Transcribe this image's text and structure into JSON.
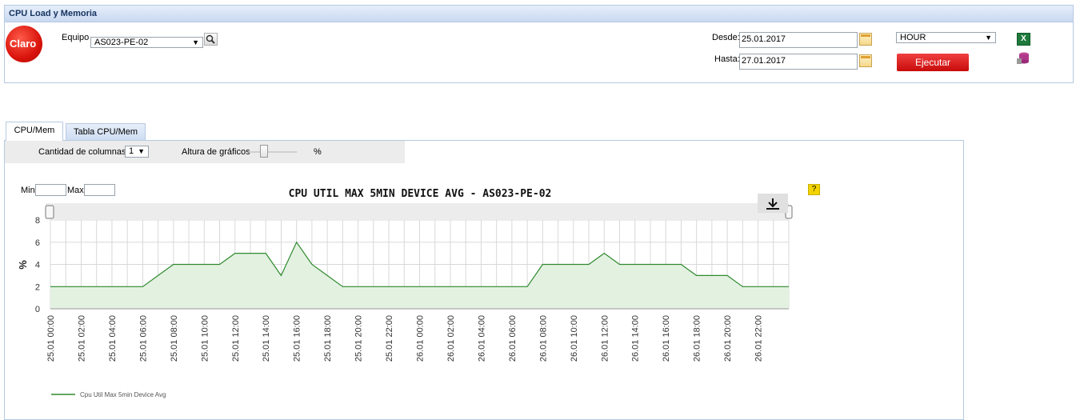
{
  "panel": {
    "title": "CPU Load y Memoria"
  },
  "logo": {
    "text": "Claro"
  },
  "equipo": {
    "label": "Equipo",
    "value": "AS023-PE-02"
  },
  "desde": {
    "label": "Desde:",
    "value": "25.01.2017"
  },
  "hasta": {
    "label": "Hasta:",
    "value": "27.01.2017"
  },
  "granularity": {
    "value": "HOUR"
  },
  "actions": {
    "ejecutar_label": "Ejecutar",
    "excel_icon": "excel-export-icon",
    "db_icon": "database-export-icon"
  },
  "tabs": [
    {
      "label": "CPU/Mem"
    },
    {
      "label": "Tabla CPU/Mem"
    }
  ],
  "toolbar": {
    "columns_label": "Cantidad de columnas",
    "columns_value": "1",
    "height_label": "Altura de gráficos",
    "height_unit": "%"
  },
  "filters": {
    "min_label": "Min",
    "max_label": "Max"
  },
  "help": {
    "label": "?"
  },
  "colors": {
    "series": "#2f8a2f",
    "fill": "#e3f1e1",
    "accent": "#e01010"
  },
  "chart_data": {
    "type": "area",
    "title": "CPU UTIL MAX 5MIN DEVICE AVG - AS023-PE-02",
    "ylabel": "%",
    "ylim": [
      0,
      8
    ],
    "yticks": [
      0,
      2,
      4,
      6,
      8
    ],
    "xticks": [
      "25.01 00:00",
      "25.01 02:00",
      "25.01 04:00",
      "25.01 06:00",
      "25.01 08:00",
      "25.01 10:00",
      "25.01 12:00",
      "25.01 14:00",
      "25.01 16:00",
      "25.01 18:00",
      "25.01 20:00",
      "25.01 22:00",
      "26.01 00:00",
      "26.01 02:00",
      "26.01 04:00",
      "26.01 06:00",
      "26.01 08:00",
      "26.01 10:00",
      "26.01 12:00",
      "26.01 14:00",
      "26.01 16:00",
      "26.01 18:00",
      "26.01 20:00",
      "26.01 22:00"
    ],
    "grid": true,
    "legend": "bottom-left",
    "series": [
      {
        "name": "Cpu Util Max 5min Device Avg",
        "values": [
          2,
          2,
          2,
          2,
          2,
          2,
          2,
          3,
          4,
          4,
          4,
          4,
          5,
          5,
          5,
          3,
          6,
          4,
          3,
          2,
          2,
          2,
          2,
          2,
          2,
          2,
          2,
          2,
          2,
          2,
          2,
          2,
          4,
          4,
          4,
          4,
          5,
          4,
          4,
          4,
          4,
          4,
          3,
          3,
          3,
          2,
          2,
          2
        ]
      }
    ]
  }
}
